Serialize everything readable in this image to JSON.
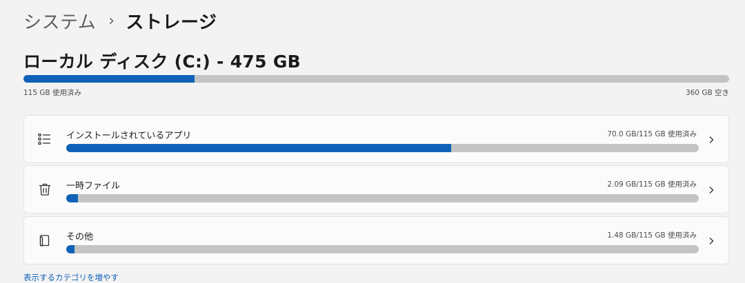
{
  "breadcrumb": {
    "parent": "システム",
    "separator": "›",
    "current": "ストレージ"
  },
  "disk": {
    "title": "ローカル ディスク (C:) - 475 GB",
    "used_label": "115 GB 使用済み",
    "free_label": "360 GB 空き",
    "used_fraction": 0.242
  },
  "categories": [
    {
      "label": "インストールされているアプリ",
      "usage": "70.0 GB/115 GB 使用済み",
      "fraction": 0.609,
      "icon": "apps-list-icon"
    },
    {
      "label": "一時ファイル",
      "usage": "2.09 GB/115 GB 使用済み",
      "fraction": 0.018,
      "icon": "trash-icon"
    },
    {
      "label": "その他",
      "usage": "1.48 GB/115 GB 使用済み",
      "fraction": 0.013,
      "icon": "other-file-icon"
    }
  ],
  "more_link": "表示するカテゴリを増やす",
  "colors": {
    "accent": "#0f62b8",
    "track": "#c4c4c4"
  }
}
